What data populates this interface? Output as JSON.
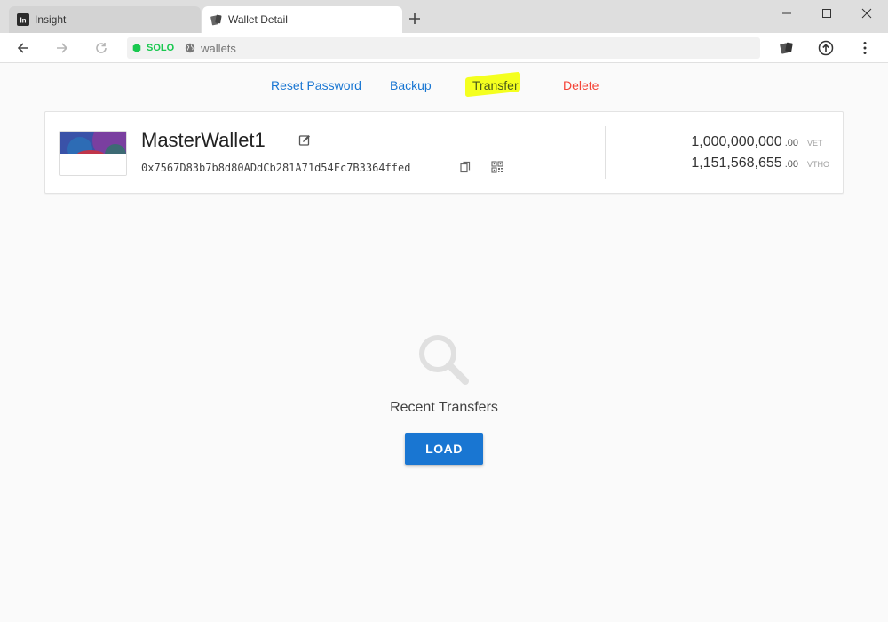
{
  "browser": {
    "tabs": [
      {
        "title": "Insight",
        "favicon": "insight-logo-icon",
        "favicon_text": "In",
        "active": false
      },
      {
        "title": "Wallet Detail",
        "favicon": "sync-cards-icon",
        "active": true
      }
    ],
    "network_badge": "SOLO",
    "url": "wallets",
    "colors": {
      "network": "#19c84f",
      "tabstrip": "#dedede"
    }
  },
  "actions": {
    "reset_password": "Reset Password",
    "backup": "Backup",
    "transfer": "Transfer",
    "delete": "Delete"
  },
  "wallet": {
    "name": "MasterWallet1",
    "address": "0x7567D83b7b8d80ADdCb281A71d54Fc7B3364ffed",
    "balances": [
      {
        "integer": "1,000,000,000",
        "decimal": ".00",
        "unit": "VET"
      },
      {
        "integer": "1,151,568,655",
        "decimal": ".00",
        "unit": "VTHO"
      }
    ]
  },
  "transfers": {
    "title": "Recent Transfers",
    "load_label": "LOAD"
  },
  "colors": {
    "primary": "#1976d2",
    "danger": "#f44336",
    "highlight": "#f4ff1f"
  }
}
